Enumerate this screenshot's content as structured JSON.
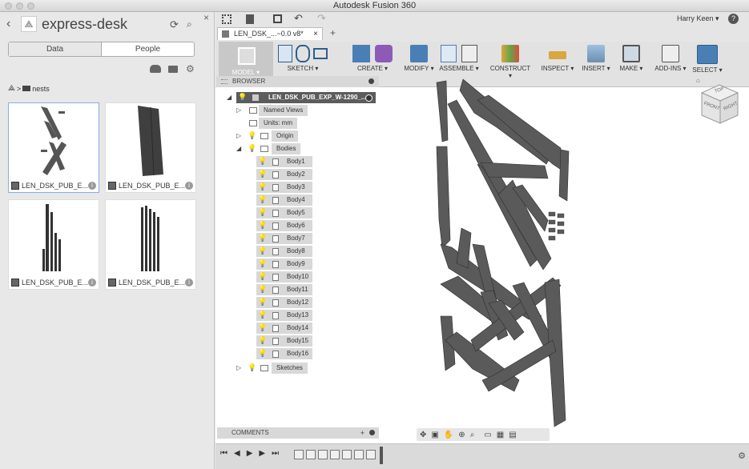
{
  "window": {
    "title": "Autodesk Fusion 360"
  },
  "left_panel": {
    "project_title": "express-desk",
    "tabs": [
      {
        "label": "Data"
      },
      {
        "label": "People"
      }
    ],
    "breadcrumb_sep": ">",
    "breadcrumb_folder": "nests",
    "files": [
      {
        "name": "LEN_DSK_PUB_E..."
      },
      {
        "name": "LEN_DSK_PUB_E..."
      },
      {
        "name": "LEN_DSK_PUB_E..."
      },
      {
        "name": "LEN_DSK_PUB_E..."
      }
    ]
  },
  "header": {
    "user": "Harry Keen ▾",
    "help": "?"
  },
  "doc_tab": {
    "label": "LEN_DSK_...~0.0 v8*"
  },
  "toolbar": {
    "model": "MODEL ▾",
    "sketch": "SKETCH ▾",
    "create": "CREATE ▾",
    "modify": "MODIFY ▾",
    "assemble": "ASSEMBLE ▾",
    "construct": "CONSTRUCT ▾",
    "inspect": "INSPECT ▾",
    "insert": "INSERT ▾",
    "make": "MAKE ▾",
    "addins": "ADD-INS ▾",
    "select": "SELECT ▾"
  },
  "browser": {
    "title": "BROWSER",
    "root": "LEN_DSK_PUB_EXP_W-1290_...",
    "named_views": "Named Views",
    "units": "Units: mm",
    "origin": "Origin",
    "bodies": "Bodies",
    "body_items": [
      "Body1",
      "Body2",
      "Body3",
      "Body4",
      "Body5",
      "Body6",
      "Body7",
      "Body8",
      "Body9",
      "Body10",
      "Body11",
      "Body12",
      "Body13",
      "Body14",
      "Body15",
      "Body16"
    ],
    "sketches": "Sketches"
  },
  "comments": {
    "title": "COMMENTS"
  },
  "viewcube": {
    "top": "TOP",
    "front": "FRONT",
    "right": "RIGHT"
  },
  "colors": {
    "accent": "#4a7fb5",
    "bulb": "#e8c200",
    "part": "#5a5a5a"
  }
}
